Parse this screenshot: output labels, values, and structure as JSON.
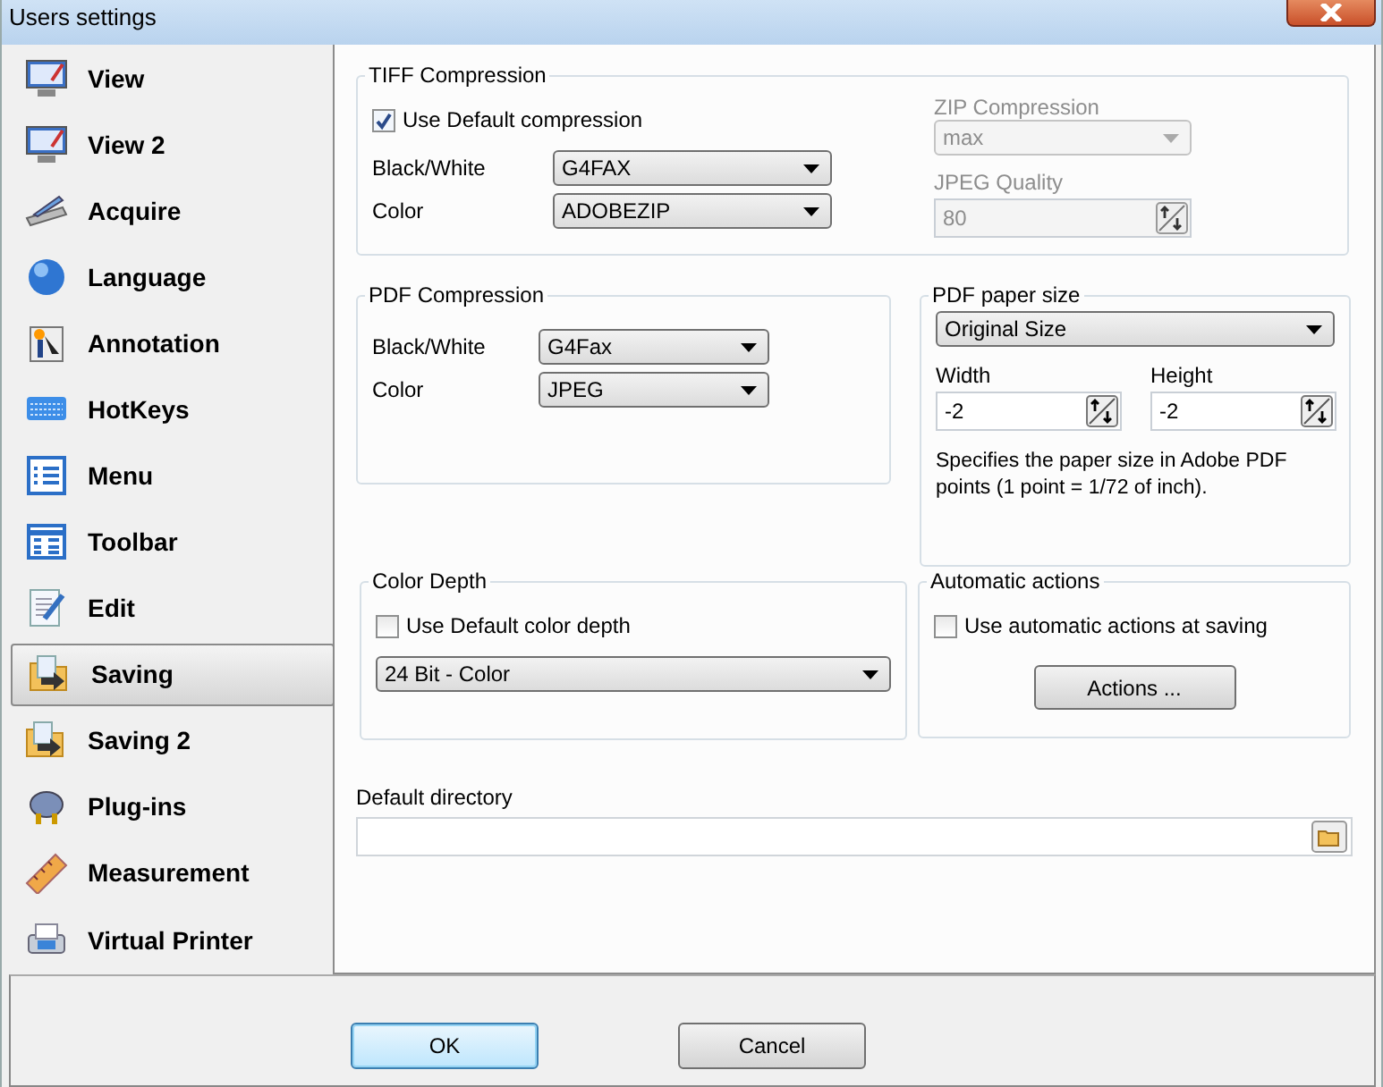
{
  "window": {
    "title": "Users settings"
  },
  "sidebar": {
    "items": [
      {
        "label": "View",
        "selected": false
      },
      {
        "label": "View 2",
        "selected": false
      },
      {
        "label": "Acquire",
        "selected": false
      },
      {
        "label": "Language",
        "selected": false
      },
      {
        "label": "Annotation",
        "selected": false
      },
      {
        "label": "HotKeys",
        "selected": false
      },
      {
        "label": "Menu",
        "selected": false
      },
      {
        "label": "Toolbar",
        "selected": false
      },
      {
        "label": "Edit",
        "selected": false
      },
      {
        "label": "Saving",
        "selected": true
      },
      {
        "label": "Saving 2",
        "selected": false
      },
      {
        "label": "Plug-ins",
        "selected": false
      },
      {
        "label": "Measurement",
        "selected": false
      },
      {
        "label": "Virtual Printer",
        "selected": false
      }
    ]
  },
  "tiff_compression": {
    "title": "TIFF Compression",
    "use_default": {
      "label": "Use Default compression",
      "checked": true
    },
    "black_white": {
      "label": "Black/White",
      "value": "G4FAX"
    },
    "color": {
      "label": "Color",
      "value": "ADOBEZIP"
    },
    "zip_compression": {
      "label": "ZIP Compression",
      "value": "max",
      "disabled": true
    },
    "jpeg_quality": {
      "label": "JPEG Quality",
      "value": "80",
      "disabled": true
    }
  },
  "pdf_compression": {
    "title": "PDF Compression",
    "black_white": {
      "label": "Black/White",
      "value": "G4Fax"
    },
    "color": {
      "label": "Color",
      "value": "JPEG"
    }
  },
  "pdf_paper_size": {
    "title": "PDF paper size",
    "size": "Original Size",
    "width": {
      "label": "Width",
      "value": "-2"
    },
    "height": {
      "label": "Height",
      "value": "-2"
    },
    "note": "Specifies the paper size in Adobe PDF points (1 point = 1/72 of inch)."
  },
  "color_depth": {
    "title": "Color Depth",
    "use_default": {
      "label": "Use Default color depth",
      "checked": false
    },
    "value": "24 Bit - Color"
  },
  "automatic_actions": {
    "title": "Automatic actions",
    "use_automatic": {
      "label": "Use automatic actions at saving",
      "checked": false
    },
    "button": "Actions ..."
  },
  "default_directory": {
    "label": "Default directory"
  },
  "buttons": [
    {
      "label": "OK",
      "default": true
    },
    {
      "label": "Cancel",
      "default": false
    }
  ]
}
